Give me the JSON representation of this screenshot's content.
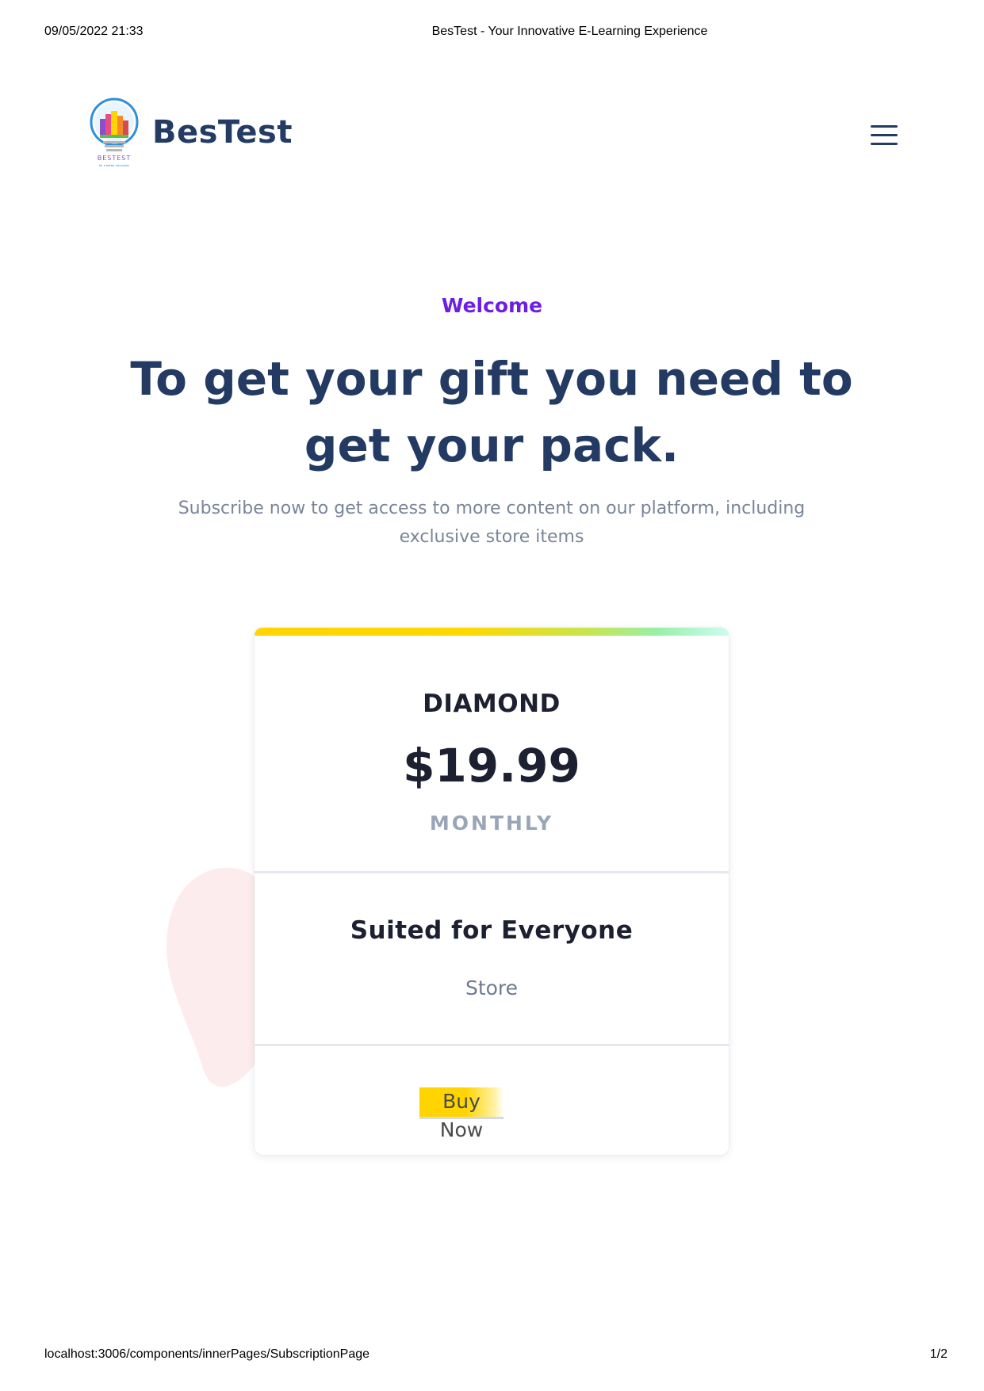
{
  "print": {
    "date": "09/05/2022 21:33",
    "title": "BesTest - Your Innovative E-Learning Experience",
    "url": "localhost:3006/components/innerPages/SubscriptionPage",
    "page": "1/2"
  },
  "navbar": {
    "logo_text": "BESTEST",
    "logo_tagline": "for a better education",
    "brand": "BesTest",
    "menu_icon": "hamburger-menu-icon"
  },
  "hero": {
    "eyebrow": "Welcome",
    "headline": "To get your gift you need to get your pack.",
    "subtitle": "Subscribe now to get access to more content on our platform, including exclusive store items"
  },
  "pricing_card": {
    "plan": "DIAMOND",
    "price": "$19.99",
    "period": "MONTHLY",
    "feature_title": "Suited for Everyone",
    "features": [
      "Store"
    ],
    "cta": "Buy Now"
  },
  "colors": {
    "brand_navy": "#243b63",
    "accent_purple": "#6d1ee3",
    "cta_yellow": "#ffd400",
    "blob_pink": "#fdecee"
  }
}
